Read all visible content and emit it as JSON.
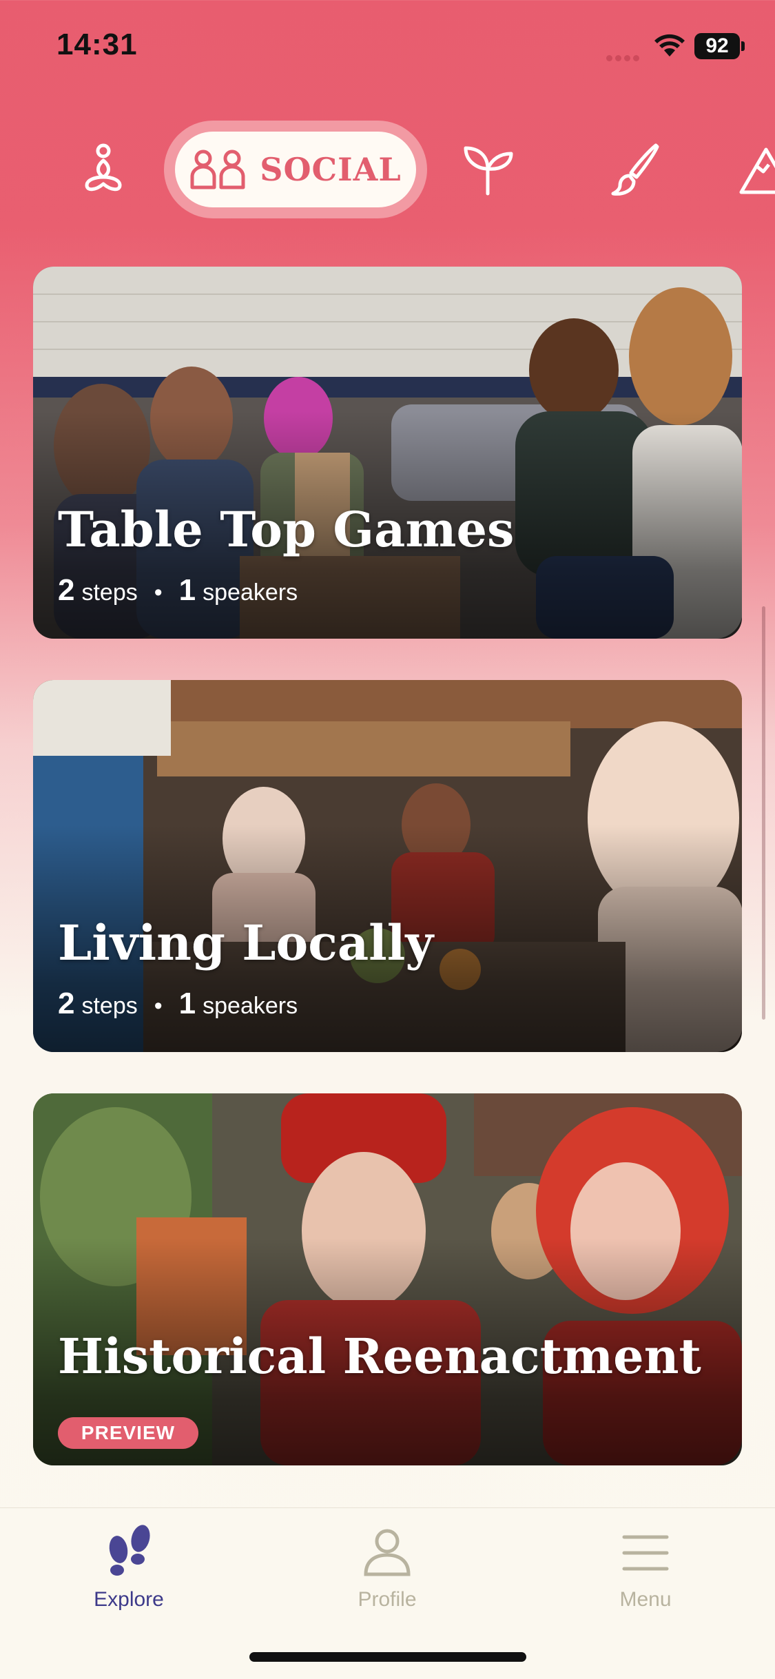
{
  "status_bar": {
    "time": "14:31",
    "battery": "92"
  },
  "categories": {
    "selected_label": "SOCIAL",
    "icons": [
      "lotus-icon",
      "people-icon",
      "sprout-icon",
      "brush-icon",
      "mountain-icon"
    ]
  },
  "cards": [
    {
      "title": "Table Top Games",
      "steps": "2",
      "steps_label": "steps",
      "speakers": "1",
      "speakers_label": "speakers"
    },
    {
      "title": "Living Locally",
      "steps": "2",
      "steps_label": "steps",
      "speakers": "1",
      "speakers_label": "speakers"
    },
    {
      "title": "Historical Reenactment",
      "badge": "PREVIEW"
    }
  ],
  "tab_bar": {
    "explore": "Explore",
    "profile": "Profile",
    "menu": "Menu",
    "active_color": "#3d3a8a",
    "inactive_color": "#b8b39f"
  },
  "colors": {
    "accent": "#e25e6e"
  }
}
